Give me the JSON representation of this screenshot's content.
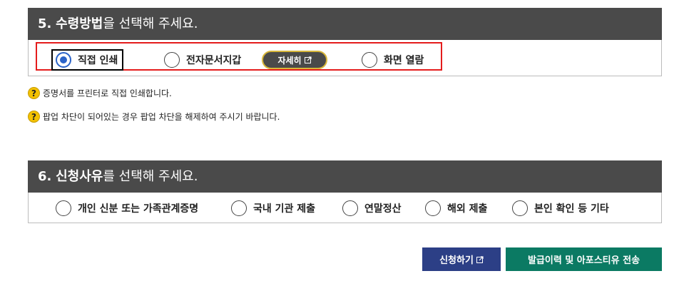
{
  "section5": {
    "number": "5.",
    "title_bold": "수령방법",
    "title_rest": "을 선택해 주세요.",
    "options": [
      {
        "label": "직접 인쇄",
        "checked": true
      },
      {
        "label": "전자문서지갑",
        "checked": false
      },
      {
        "label": "화면 열람",
        "checked": false
      }
    ],
    "detail_button_label": "자세히"
  },
  "notes": [
    "증명서를 프린터로 직접 인쇄합니다.",
    "팝업 차단이 되어있는 경우 팝업 차단을 해제하여 주시기 바랍니다."
  ],
  "section6": {
    "number": "6.",
    "title_bold": "신청사유",
    "title_rest": "를 선택해 주세요.",
    "options": [
      {
        "label": "개인 신분 또는 가족관계증명",
        "checked": false
      },
      {
        "label": "국내 기관 제출",
        "checked": false
      },
      {
        "label": "연말정산",
        "checked": false
      },
      {
        "label": "해외 제출",
        "checked": false
      },
      {
        "label": "본인 확인 등 기타",
        "checked": false
      }
    ]
  },
  "buttons": {
    "apply_label": "신청하기",
    "send_label": "발급이력 및 아포스티유 전송"
  },
  "colors": {
    "header_bg": "#4a4a4a",
    "highlight_frame": "#e41c1c",
    "radio_checked": "#2b63c8",
    "apply_bg": "#2c3f86",
    "send_bg": "#0b7a63",
    "help_icon": "#f3c100"
  },
  "icons": {
    "external_link": "external-link-icon",
    "help": "question-icon",
    "radio": "radio-icon"
  }
}
